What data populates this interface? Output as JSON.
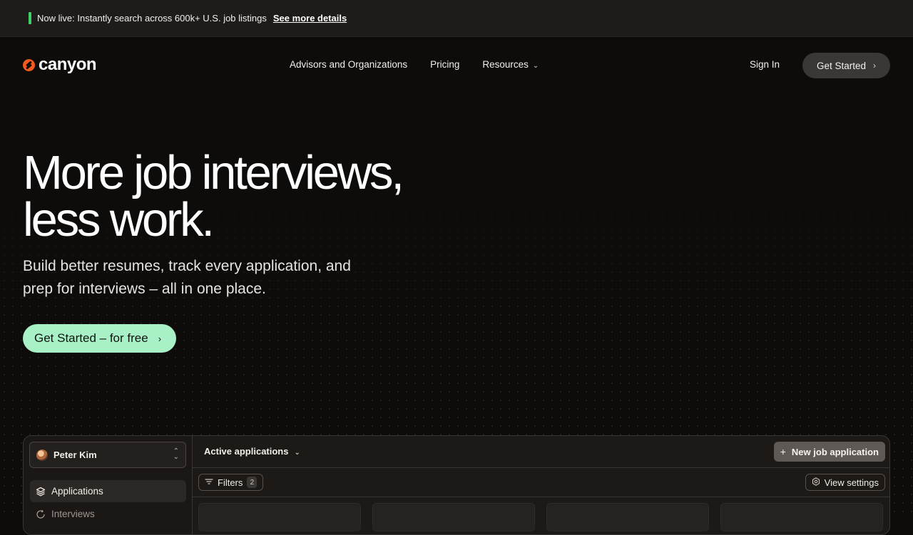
{
  "announcement": {
    "message": "Now live: Instantly search across 600k+ U.S. job listings",
    "link": "See more details",
    "accent_color": "#3ccf6a"
  },
  "nav": {
    "logo_text": "canyon",
    "logo_color": "#f25a1e",
    "links": [
      "Advisors and Organizations",
      "Pricing",
      "Resources"
    ],
    "resources_icon": "chevron-down-icon",
    "sign_in": "Sign In",
    "get_started": "Get Started"
  },
  "hero": {
    "title_line1": "More job interviews,",
    "title_line2": "less work.",
    "subtitle": "Build better resumes, track every application, and prep for interviews – all in one place.",
    "cta": "Get Started – for free",
    "cta_color": "#a8f0c6"
  },
  "app_preview": {
    "user_name": "Peter Kim",
    "sidebar_items": [
      "Applications",
      "Interviews"
    ],
    "view_name": "Active applications",
    "new_button": "New job application",
    "filters_label": "Filters",
    "filters_count": "2",
    "view_settings": "View settings"
  }
}
